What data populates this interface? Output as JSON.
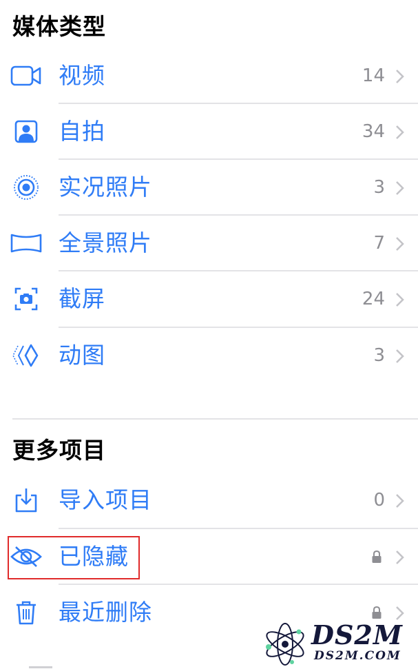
{
  "media_types": {
    "title": "媒体类型",
    "items": [
      {
        "label": "视频",
        "count": "14",
        "icon": "video-camera-icon"
      },
      {
        "label": "自拍",
        "count": "34",
        "icon": "portrait-icon"
      },
      {
        "label": "实况照片",
        "count": "3",
        "icon": "live-photo-icon"
      },
      {
        "label": "全景照片",
        "count": "7",
        "icon": "panorama-icon"
      },
      {
        "label": "截屏",
        "count": "24",
        "icon": "screenshot-icon"
      },
      {
        "label": "动图",
        "count": "3",
        "icon": "animated-icon"
      }
    ]
  },
  "more_items": {
    "title": "更多项目",
    "items": [
      {
        "label": "导入项目",
        "count": "0",
        "icon": "import-icon"
      },
      {
        "label": "已隐藏",
        "count": "",
        "icon": "eye-slash-icon",
        "locked": true
      },
      {
        "label": "最近删除",
        "count": "",
        "icon": "trash-icon",
        "locked": true
      }
    ]
  },
  "watermark": {
    "logo": "DS2M",
    "url": "DS2M.COM"
  },
  "colors": {
    "accent": "#2f7cf6",
    "secondary_text": "#8e8e93",
    "divider": "#e3e3e6",
    "highlight": "#e02a2a"
  }
}
